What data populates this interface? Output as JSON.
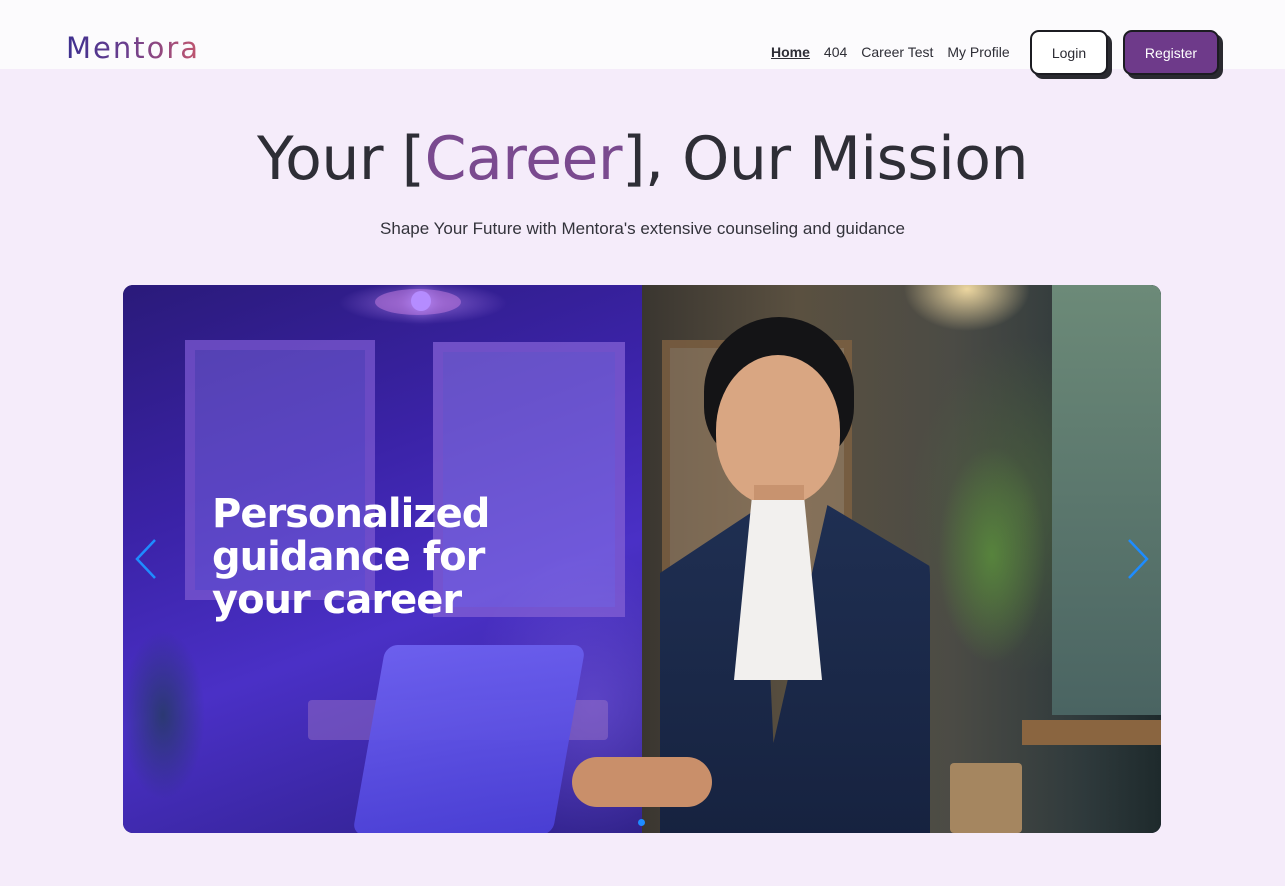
{
  "brand": {
    "logo_text": "Mentora"
  },
  "nav": {
    "links": [
      {
        "label": "Home",
        "active": true
      },
      {
        "label": "404",
        "active": false
      },
      {
        "label": "Career Test",
        "active": false
      },
      {
        "label": "My Profile",
        "active": false
      }
    ],
    "login_label": "Login",
    "register_label": "Register"
  },
  "hero": {
    "title_prefix": "Your [",
    "title_accent": "Career",
    "title_suffix": "], Our Mission",
    "subtitle": "Shape Your Future with Mentora's extensive counseling and guidance"
  },
  "carousel": {
    "slide_heading": "Personalized guidance for your career",
    "prev_icon": "chevron-left-icon",
    "next_icon": "chevron-right-icon",
    "slide_count": 1,
    "active_slide": 1
  },
  "colors": {
    "page_background": "#f5ecfa",
    "header_background": "#fcfbfd",
    "accent_purple": "#6e3a8a",
    "title_accent": "#7a4a8f",
    "carousel_control_blue": "#1e8cff"
  }
}
